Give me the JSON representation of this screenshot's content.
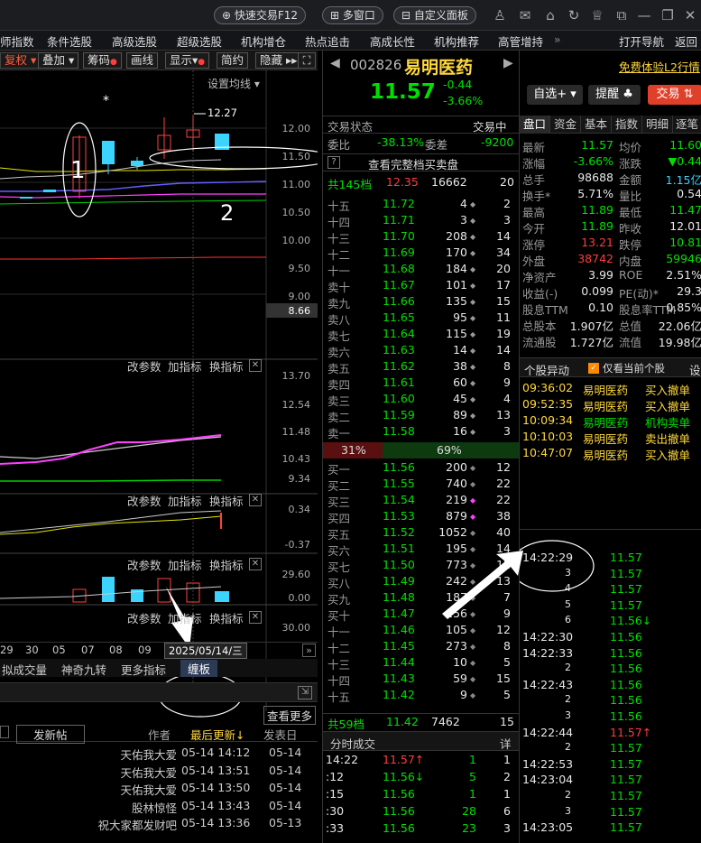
{
  "toolbar": {
    "quick_trade": "快速交易F12",
    "multi_window": "多窗口",
    "custom_panel": "自定义面板"
  },
  "menu": [
    "师指数",
    "条件选股",
    "高级选股",
    "超级选股",
    "机构增仓",
    "热点追击",
    "高成长性",
    "机构推荐",
    "高管增持",
    "»",
    "打开导航",
    "返回"
  ],
  "chartbar": {
    "fq": "复权",
    "overlay": "叠加",
    "chips": "筹码",
    "draw": "画线",
    "display": "显示",
    "simple": "简约",
    "hide": "隐藏"
  },
  "kline": {
    "ma_setting": "设置均线",
    "max_label": "12.27",
    "ticks": [
      "12.00",
      "11.50",
      "11.00",
      "10.50",
      "10.00",
      "9.50",
      "9.00",
      "8.66"
    ],
    "annot1": "1",
    "annot2": "2"
  },
  "ind": {
    "params": "改参数",
    "add": "加指标",
    "switch": "换指标",
    "v_ticks": [
      "13.70",
      "12.54",
      "11.48",
      "10.43",
      "9.34"
    ],
    "m_ticks": [
      "0.34",
      "-0.37"
    ],
    "k_ticks": [
      "29.60",
      "0.00"
    ],
    "bot_tick": "30.00"
  },
  "xaxis": {
    "labels": [
      "29",
      "30",
      "05",
      "07",
      "08",
      "09"
    ],
    "cursor_date": "2025/05/14/三"
  },
  "tabs2": [
    "拟成交量",
    "神奇九转",
    "更多指标",
    "缠板"
  ],
  "posts": {
    "new_post": "发新帖",
    "author": "作者",
    "last_update": "最后更新↓",
    "publish": "发表日",
    "more": "查看更多",
    "rows": [
      {
        "author": "天佑我大爱",
        "last": "05-14 14:12",
        "pub": "05-14"
      },
      {
        "author": "天佑我大爱",
        "last": "05-14 13:51",
        "pub": "05-14"
      },
      {
        "author": "天佑我大爱",
        "last": "05-14 13:50",
        "pub": "05-14"
      },
      {
        "author": "股林惊怪",
        "last": "05-14 13:43",
        "pub": "05-14"
      },
      {
        "author": "祝大家都发财吧",
        "last": "05-14 13:36",
        "pub": "05-13"
      }
    ]
  },
  "stock": {
    "code": "002826",
    "name": "易明医药",
    "price": "11.57",
    "change": "-0.44",
    "pct": "-3.66%",
    "select": "自选+",
    "remind": "提醒",
    "trade": "交易"
  },
  "orderbook": {
    "status_label": "交易状态",
    "status_val": "交易中",
    "wb_label": "委比",
    "wb_val": "-38.13%",
    "wc_label": "委差",
    "wc_val": "-9200",
    "full_link": "查看完整档买卖盘",
    "total_top": "共145档",
    "top_price": "12.35",
    "top_vol": "16662",
    "top_n": "20",
    "asks": [
      [
        "十五",
        "11.72",
        "4",
        "2"
      ],
      [
        "十四",
        "11.71",
        "3",
        "3"
      ],
      [
        "十三",
        "11.70",
        "208",
        "14"
      ],
      [
        "十二",
        "11.69",
        "170",
        "34"
      ],
      [
        "十一",
        "11.68",
        "184",
        "20"
      ],
      [
        "卖十",
        "11.67",
        "101",
        "17"
      ],
      [
        "卖九",
        "11.66",
        "135",
        "15"
      ],
      [
        "卖八",
        "11.65",
        "95",
        "11"
      ],
      [
        "卖七",
        "11.64",
        "115",
        "19"
      ],
      [
        "卖六",
        "11.63",
        "14",
        "14"
      ],
      [
        "卖五",
        "11.62",
        "38",
        "8"
      ],
      [
        "卖四",
        "11.61",
        "60",
        "9"
      ],
      [
        "卖三",
        "11.60",
        "45",
        "4"
      ],
      [
        "卖二",
        "11.59",
        "89",
        "13"
      ],
      [
        "卖一",
        "11.58",
        "16",
        "3"
      ]
    ],
    "ratio_sell": "31%",
    "ratio_buy": "69%",
    "bids": [
      [
        "买一",
        "11.56",
        "200",
        "12"
      ],
      [
        "买二",
        "11.55",
        "740",
        "22"
      ],
      [
        "买三",
        "11.54",
        "219",
        "22"
      ],
      [
        "买四",
        "11.53",
        "879",
        "38"
      ],
      [
        "买五",
        "11.52",
        "1052",
        "40"
      ],
      [
        "买六",
        "11.51",
        "195",
        "14"
      ],
      [
        "买七",
        "11.50",
        "773",
        "12"
      ],
      [
        "买八",
        "11.49",
        "242",
        "13"
      ],
      [
        "买九",
        "11.48",
        "187",
        "7"
      ],
      [
        "买十",
        "11.47",
        "156",
        "9"
      ],
      [
        "十一",
        "11.46",
        "105",
        "12"
      ],
      [
        "十二",
        "11.45",
        "273",
        "8"
      ],
      [
        "十三",
        "11.44",
        "10",
        "5"
      ],
      [
        "十四",
        "11.43",
        "59",
        "15"
      ],
      [
        "十五",
        "11.42",
        "9",
        "5"
      ]
    ],
    "total_bot": "共59档",
    "bot_price": "11.42",
    "bot_vol": "7462",
    "bot_n": "15",
    "fenshi_title": "分时成交",
    "fenshi_detail": "详",
    "fenshi": [
      [
        "14:22",
        "11.57↑",
        "1",
        "1"
      ],
      [
        ":12",
        "11.56↓",
        "5",
        "2"
      ],
      [
        ":15",
        "11.56",
        "1",
        "1"
      ],
      [
        ":30",
        "11.56",
        "28",
        "6"
      ],
      [
        ":33",
        "11.56",
        "23",
        "3"
      ]
    ]
  },
  "quote": {
    "tabs": [
      "盘口",
      "资金",
      "基本",
      "指数",
      "明细",
      "逐笔"
    ],
    "rows": [
      [
        "最新",
        "11.57",
        "均价",
        "11.60"
      ],
      [
        "涨幅",
        "-3.66%",
        "涨跌",
        "▼0.44"
      ],
      [
        "总手",
        "98688",
        "金额",
        "1.15亿"
      ],
      [
        "换手*",
        "5.71%",
        "量比",
        "0.54"
      ],
      [
        "最高",
        "11.89",
        "最低",
        "11.47"
      ],
      [
        "今开",
        "11.89",
        "昨收",
        "12.01"
      ],
      [
        "涨停",
        "13.21",
        "跌停",
        "10.81"
      ],
      [
        "外盘",
        "38742",
        "内盘",
        "59946"
      ],
      [
        "净资产",
        "3.99",
        "ROE",
        "2.51%"
      ],
      [
        "收益(-)",
        "0.099",
        "PE(动)*",
        "29.3"
      ],
      [
        "股息TTM",
        "0.10",
        "股息率TTM",
        "0.85%"
      ],
      [
        "总股本",
        "1.907亿",
        "总值",
        "22.06亿"
      ],
      [
        "流通股",
        "1.727亿",
        "流值",
        "19.98亿"
      ]
    ]
  },
  "anomaly": {
    "title": "个股异动",
    "only_current": "仅看当前个股",
    "setting": "设",
    "rows": [
      [
        "09:36:02",
        "易明医药",
        "买入撤单"
      ],
      [
        "09:52:35",
        "易明医药",
        "买入撤单"
      ],
      [
        "10:09:34",
        "易明医药",
        "机构卖单"
      ],
      [
        "10:10:03",
        "易明医药",
        "卖出撤单"
      ],
      [
        "10:47:07",
        "易明医药",
        "买入撤单"
      ]
    ]
  },
  "ticks": [
    [
      "14:22:29",
      "11.57"
    ],
    [
      "3",
      "11.57"
    ],
    [
      "4",
      "11.57"
    ],
    [
      "5",
      "11.57"
    ],
    [
      "6",
      "11.56↓"
    ],
    [
      "14:22:30",
      "11.56"
    ],
    [
      "14:22:33",
      "11.56"
    ],
    [
      "2",
      "11.56"
    ],
    [
      "14:22:43",
      "11.56"
    ],
    [
      "2",
      "11.56"
    ],
    [
      "3",
      "11.56"
    ],
    [
      "14:22:44",
      "11.57↑"
    ],
    [
      "2",
      "11.57"
    ],
    [
      "14:22:53",
      "11.57"
    ],
    [
      "14:23:04",
      "11.57"
    ],
    [
      "2",
      "11.57"
    ],
    [
      "3",
      "11.57"
    ],
    [
      "14:23:05",
      "11.57"
    ]
  ]
}
